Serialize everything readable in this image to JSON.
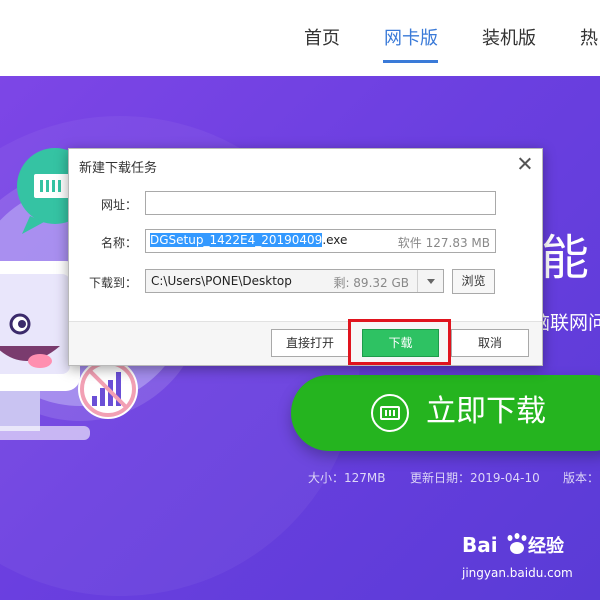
{
  "nav": {
    "items": [
      {
        "label": "首页",
        "active": false
      },
      {
        "label": "网卡版",
        "active": true
      },
      {
        "label": "装机版",
        "active": false
      },
      {
        "label": "热",
        "active": false
      }
    ]
  },
  "hero": {
    "headline": "能",
    "subline": "脑联网问",
    "download_label": "立即下载",
    "meta": {
      "size": "大小：127MB",
      "date": "更新日期：2019-04-10",
      "version": "版本："
    }
  },
  "dialog": {
    "title": "新建下载任务",
    "url_label": "网址：",
    "url_value": "",
    "name_label": "名称：",
    "name_selected": "DGSetup_1422E4_20190409",
    "name_ext": ".exe",
    "name_size": "软件 127.83 MB",
    "path_label": "下载到：",
    "path_value": "C:\\Users\\PONE\\Desktop",
    "path_free": "剩: 89.32 GB",
    "browse_label": "浏览",
    "open_label": "直接打开",
    "download_label": "下载",
    "cancel_label": "取消"
  },
  "watermark": {
    "logo_text": "Bai du 经验",
    "url": "jingyan.baidu.com"
  },
  "colors": {
    "accent": "#3a7ad8",
    "hero_purple": "#6b3fe0",
    "download_green": "#25b41f",
    "dialog_ok_green": "#2ec263",
    "highlight_red": "#e0141e"
  }
}
